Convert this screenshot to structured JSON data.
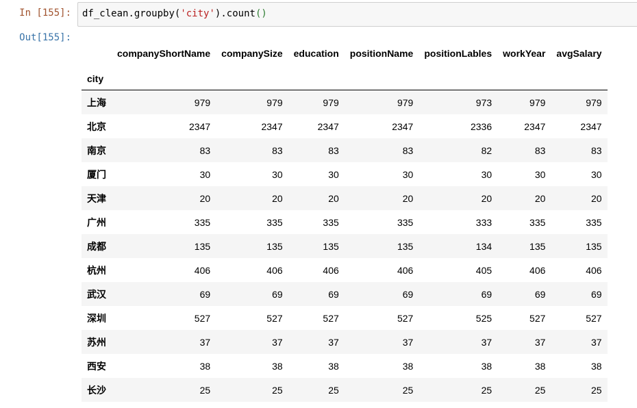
{
  "cell": {
    "in_prompt": "In [155]:",
    "out_prompt": "Out[155]:",
    "code": {
      "obj": "df_clean",
      "method1": "groupby",
      "paren1_open": "(",
      "arg": "'city'",
      "paren1_close": ")",
      "method2": "count",
      "paren2": "()"
    }
  },
  "table": {
    "index_name": "city",
    "columns": [
      "companyShortName",
      "companySize",
      "education",
      "positionName",
      "positionLables",
      "workYear",
      "avgSalary"
    ],
    "rows": [
      {
        "index": "上海",
        "values": [
          "979",
          "979",
          "979",
          "979",
          "973",
          "979",
          "979"
        ]
      },
      {
        "index": "北京",
        "values": [
          "2347",
          "2347",
          "2347",
          "2347",
          "2336",
          "2347",
          "2347"
        ]
      },
      {
        "index": "南京",
        "values": [
          "83",
          "83",
          "83",
          "83",
          "82",
          "83",
          "83"
        ]
      },
      {
        "index": "厦门",
        "values": [
          "30",
          "30",
          "30",
          "30",
          "30",
          "30",
          "30"
        ]
      },
      {
        "index": "天津",
        "values": [
          "20",
          "20",
          "20",
          "20",
          "20",
          "20",
          "20"
        ]
      },
      {
        "index": "广州",
        "values": [
          "335",
          "335",
          "335",
          "335",
          "333",
          "335",
          "335"
        ]
      },
      {
        "index": "成都",
        "values": [
          "135",
          "135",
          "135",
          "135",
          "134",
          "135",
          "135"
        ]
      },
      {
        "index": "杭州",
        "values": [
          "406",
          "406",
          "406",
          "406",
          "405",
          "406",
          "406"
        ]
      },
      {
        "index": "武汉",
        "values": [
          "69",
          "69",
          "69",
          "69",
          "69",
          "69",
          "69"
        ]
      },
      {
        "index": "深圳",
        "values": [
          "527",
          "527",
          "527",
          "527",
          "525",
          "527",
          "527"
        ]
      },
      {
        "index": "苏州",
        "values": [
          "37",
          "37",
          "37",
          "37",
          "37",
          "37",
          "37"
        ]
      },
      {
        "index": "西安",
        "values": [
          "38",
          "38",
          "38",
          "38",
          "38",
          "38",
          "38"
        ]
      },
      {
        "index": "长沙",
        "values": [
          "25",
          "25",
          "25",
          "25",
          "25",
          "25",
          "25"
        ]
      }
    ]
  }
}
